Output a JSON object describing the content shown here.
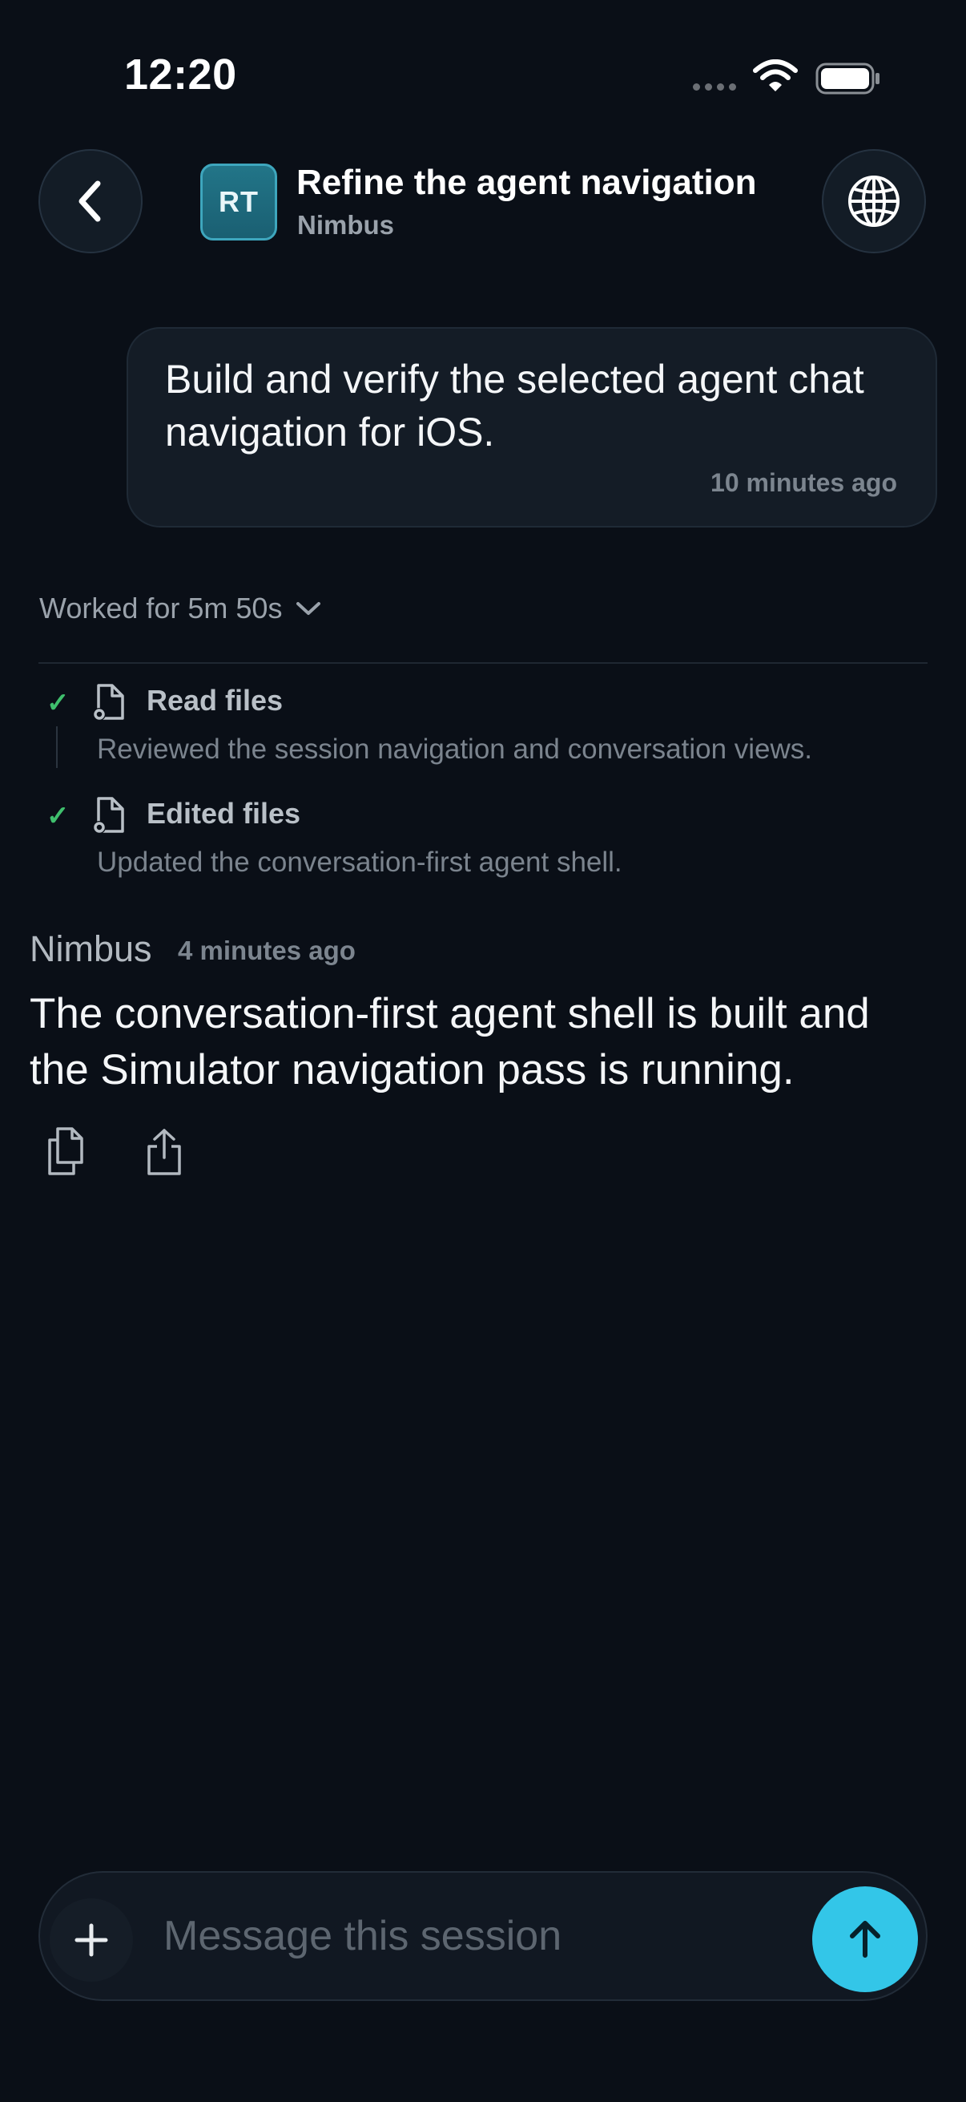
{
  "status_bar": {
    "time": "12:20",
    "icons": [
      "cellular-signal-icon",
      "wifi-icon",
      "battery-icon"
    ]
  },
  "header": {
    "back_icon": "chevron-left-icon",
    "avatar_initials": "RT",
    "title": "Refine the agent navigation",
    "subtitle": "Nimbus",
    "globe_icon": "globe-icon"
  },
  "user_message": {
    "text": "Build and verify the selected agent chat navigation for iOS.",
    "timestamp": "10 minutes ago"
  },
  "work_summary": {
    "label": "Worked for 5m 50s",
    "expand_icon": "chevron-down-icon",
    "steps": [
      {
        "title": "Read files",
        "description": "Reviewed the session navigation and conversation views.",
        "icon": "document-gear-icon",
        "status": "done"
      },
      {
        "title": "Edited files",
        "description": "Updated the conversation-first agent shell.",
        "icon": "document-gear-icon",
        "status": "done"
      }
    ]
  },
  "agent_message": {
    "name": "Nimbus",
    "timestamp": "4 minutes ago",
    "text": "The conversation-first agent shell is built and the Simulator navigation pass is running.",
    "actions": [
      "copy-icon",
      "share-icon"
    ]
  },
  "composer": {
    "placeholder": "Message this session",
    "value": "",
    "add_icon": "plus-icon",
    "send_icon": "arrow-up-icon"
  },
  "colors": {
    "background": "#0a0f17",
    "accent": "#33c6e8",
    "success": "#3fbf6d",
    "avatar": "#1f6b7e"
  }
}
